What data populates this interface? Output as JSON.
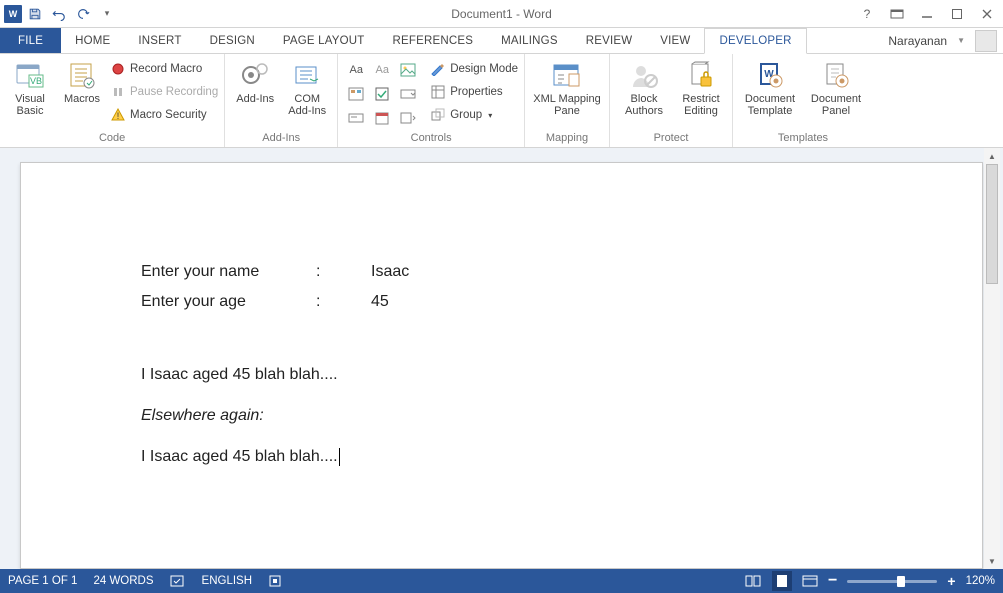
{
  "title": "Document1 - Word",
  "qat": {
    "save": "Save",
    "undo": "Undo",
    "redo": "Redo"
  },
  "tabs": {
    "file": "FILE",
    "home": "HOME",
    "insert": "INSERT",
    "design": "DESIGN",
    "pagelayout": "PAGE LAYOUT",
    "references": "REFERENCES",
    "mailings": "MAILINGS",
    "review": "REVIEW",
    "view": "VIEW",
    "developer": "DEVELOPER"
  },
  "user": "Narayanan",
  "ribbon": {
    "code": {
      "label": "Code",
      "visual_basic": "Visual Basic",
      "macros": "Macros",
      "record": "Record Macro",
      "pause": "Pause Recording",
      "security": "Macro Security"
    },
    "addins": {
      "label": "Add-Ins",
      "addins": "Add-Ins",
      "com": "COM Add-Ins"
    },
    "controls": {
      "label": "Controls",
      "design_mode": "Design Mode",
      "properties": "Properties",
      "group": "Group"
    },
    "mapping": {
      "label": "Mapping",
      "xml": "XML Mapping Pane"
    },
    "protect": {
      "label": "Protect",
      "block": "Block Authors",
      "restrict": "Restrict Editing"
    },
    "templates": {
      "label": "Templates",
      "doc_template": "Document Template",
      "doc_panel": "Document Panel"
    }
  },
  "document": {
    "row1_label": "Enter your name",
    "row1_value": "Isaac",
    "row2_label": "Enter your age",
    "row2_value": "45",
    "para1": "I Isaac aged 45 blah blah....",
    "para2": "Elsewhere again:",
    "para3": "I Isaac aged 45 blah blah...."
  },
  "status": {
    "page": "PAGE 1 OF 1",
    "words": "24 WORDS",
    "lang": "ENGLISH",
    "zoom": "120%"
  }
}
